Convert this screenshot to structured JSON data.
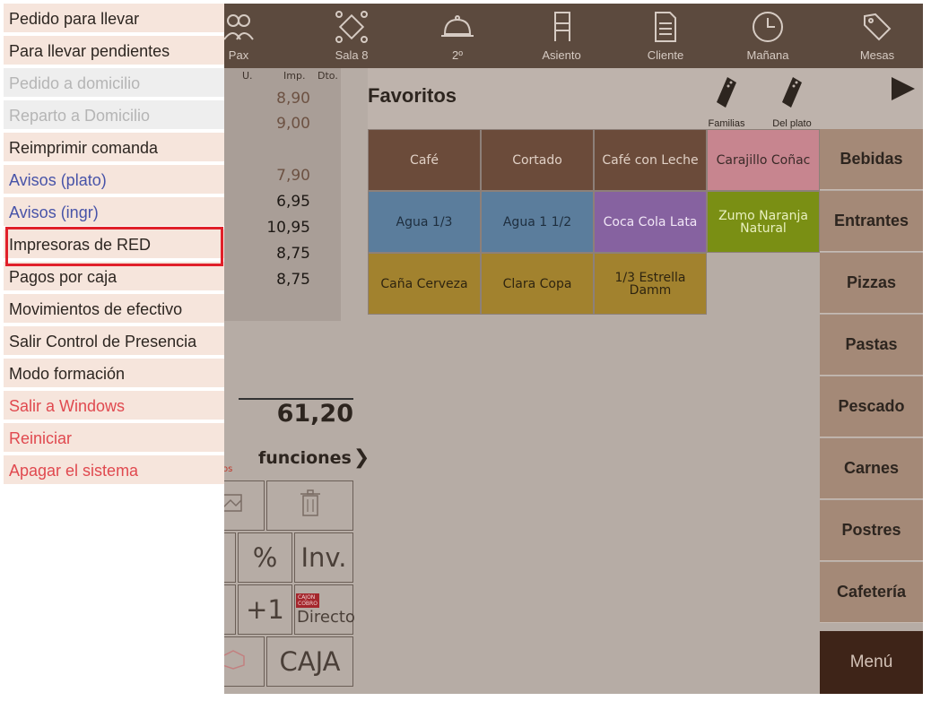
{
  "menu": {
    "items": [
      {
        "label": "Pedido para llevar",
        "state": "normal"
      },
      {
        "label": "Para llevar pendientes",
        "state": "normal"
      },
      {
        "label": "Pedido a domicilio",
        "state": "disabled"
      },
      {
        "label": "Reparto a Domicilio",
        "state": "disabled"
      },
      {
        "label": "Reimprimir comanda",
        "state": "normal"
      },
      {
        "label": "Avisos (plato)",
        "state": "blue"
      },
      {
        "label": "Avisos (ingr)",
        "state": "blue"
      },
      {
        "label": "Impresoras de RED",
        "state": "normal"
      },
      {
        "label": "Pagos por caja",
        "state": "normal"
      },
      {
        "label": "Movimientos de efectivo",
        "state": "normal"
      },
      {
        "label": "Salir Control de Presencia",
        "state": "normal"
      },
      {
        "label": "Modo formación",
        "state": "normal"
      },
      {
        "label": "Salir a Windows",
        "state": "red"
      },
      {
        "label": "Reiniciar",
        "state": "red"
      },
      {
        "label": "Apagar el sistema",
        "state": "red"
      }
    ]
  },
  "topbar": {
    "buttons": [
      {
        "label": "Pax",
        "icon": "people-icon"
      },
      {
        "label": "Sala 8",
        "icon": "table-icon"
      },
      {
        "label": "2º",
        "icon": "cloche-icon"
      },
      {
        "label": "Asiento",
        "icon": "chair-icon"
      },
      {
        "label": "Cliente",
        "icon": "client-card-icon"
      },
      {
        "label": "Mañana",
        "icon": "clock-icon"
      },
      {
        "label": "Mesas",
        "icon": "tags-icon"
      }
    ]
  },
  "order": {
    "headers": {
      "unit": "U.",
      "amount": "Imp.",
      "discount": "Dto."
    },
    "prices": [
      {
        "value": "8,90",
        "muted": true
      },
      {
        "value": "9,00",
        "muted": true
      },
      {
        "value": "7,90",
        "muted": true
      },
      {
        "value": "6,95",
        "muted": false
      },
      {
        "value": "10,95",
        "muted": false
      },
      {
        "value": "8,75",
        "muted": false
      },
      {
        "value": "8,75",
        "muted": false
      }
    ],
    "total": "61,20",
    "note_fragment": "os"
  },
  "functions": {
    "label": "funciones",
    "keys": {
      "percent": "%",
      "inv": "Inv.",
      "plus_one": "+1",
      "directo": "Directo",
      "directo_badge_line1": "CAJON",
      "directo_badge_line2": "COBRO",
      "caja": "CAJA"
    }
  },
  "favorites": {
    "title": "Favoritos",
    "familias_label": "Familias",
    "delplato_label": "Del plato",
    "products": [
      {
        "label": "Café",
        "color": "#6b4b3a",
        "text_color": "#e0d0c5"
      },
      {
        "label": "Cortado",
        "color": "#6b4b3a",
        "text_color": "#e0d0c5"
      },
      {
        "label": "Café con Leche",
        "color": "#6b4b3a",
        "text_color": "#e0d0c5"
      },
      {
        "label": "Carajillo Coñac",
        "color": "#c7858f",
        "text_color": "#3a2a28"
      },
      {
        "label": "Agua 1/3",
        "color": "#5b7d9c",
        "text_color": "#1e2e3e"
      },
      {
        "label": "Agua 1 1/2",
        "color": "#5b7d9c",
        "text_color": "#1e2e3e"
      },
      {
        "label": "Coca Cola Lata",
        "color": "#8662a0",
        "text_color": "#f1e6f6"
      },
      {
        "label": "Zumo Naranja Natural",
        "color": "#7a8f14",
        "text_color": "#e9f0c0"
      },
      {
        "label": "Caña Cerveza",
        "color": "#a2822e",
        "text_color": "#2e2410"
      },
      {
        "label": "Clara Copa",
        "color": "#a2822e",
        "text_color": "#2e2410"
      },
      {
        "label": "1/3 Estrella Damm",
        "color": "#a2822e",
        "text_color": "#2e2410"
      }
    ]
  },
  "categories": [
    "Bebidas",
    "Entrantes",
    "Pizzas",
    "Pastas",
    "Pescado",
    "Carnes",
    "Postres",
    "Cafetería"
  ],
  "menu_button": "Menú",
  "colors": {
    "highlight": "#e0202a",
    "background": "#b6aca5",
    "topbar": "#5c4a3e"
  }
}
